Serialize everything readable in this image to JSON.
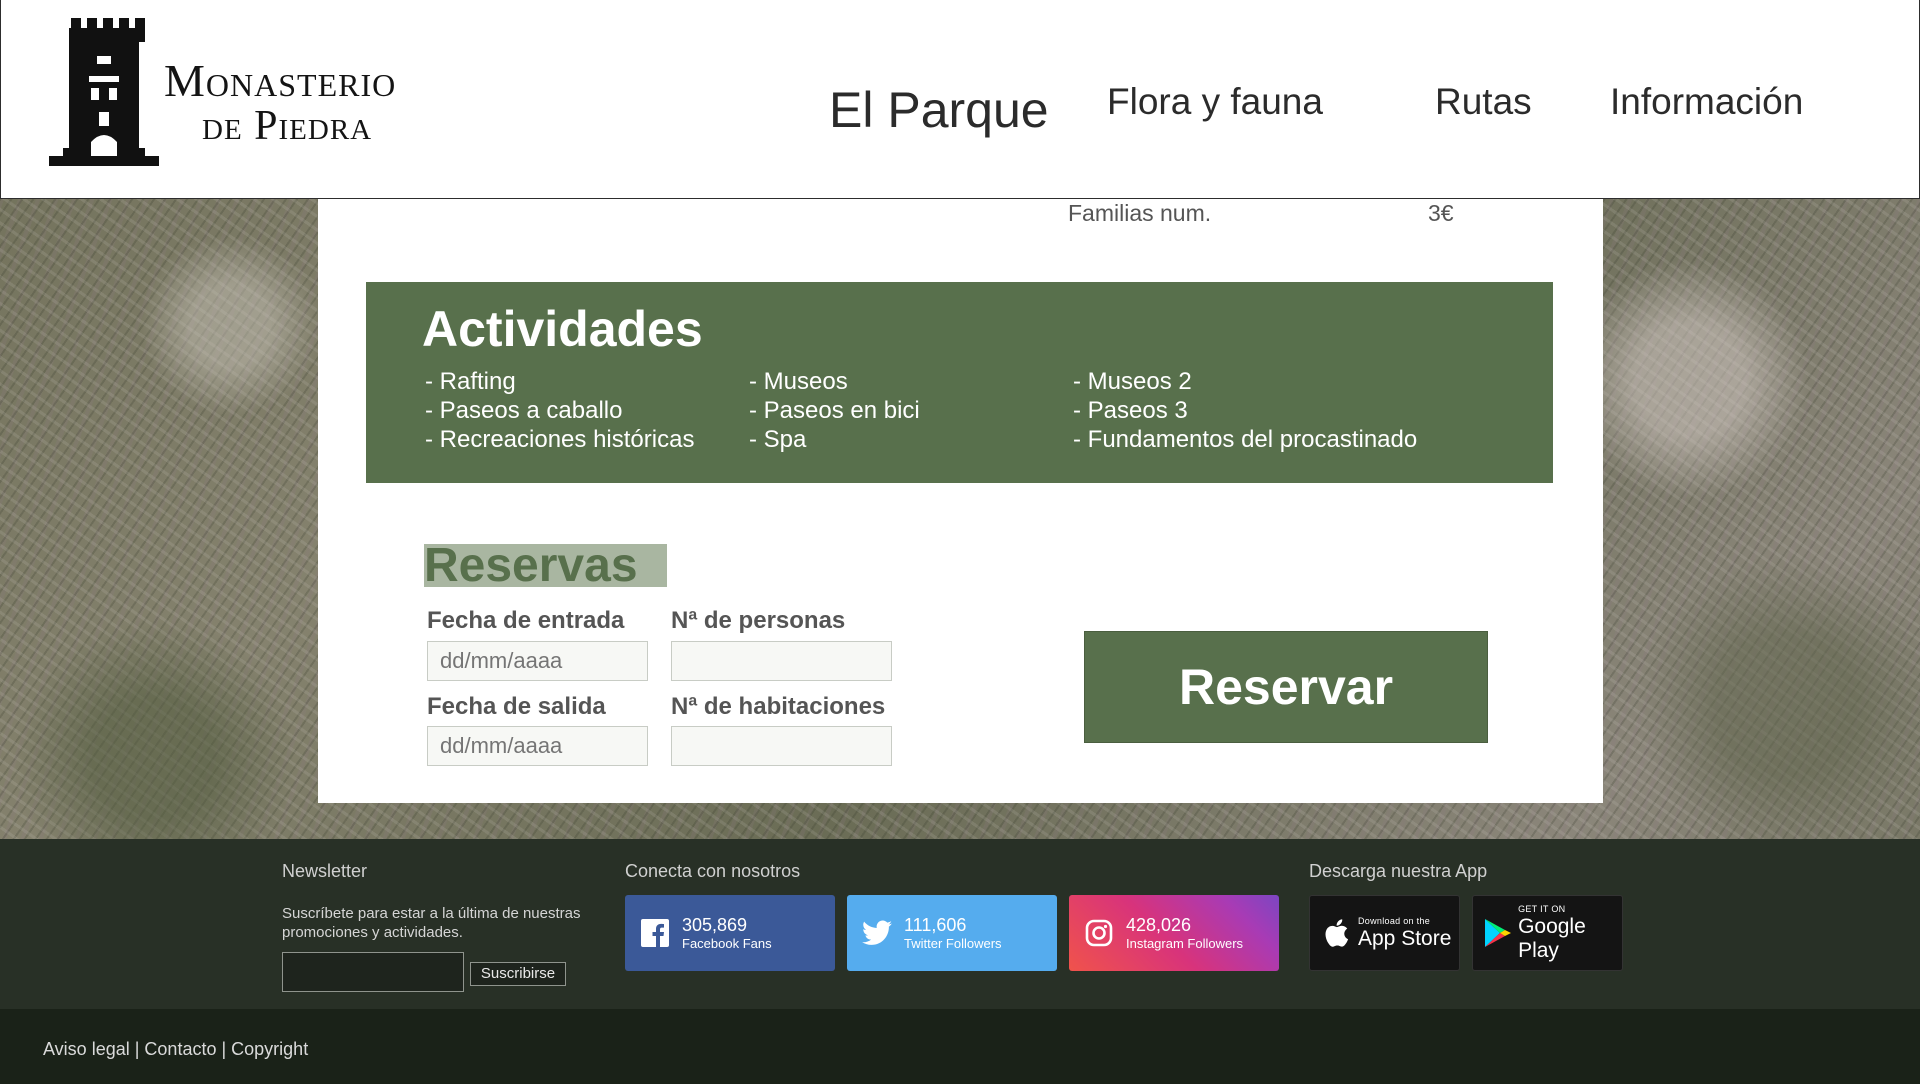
{
  "header": {
    "logo": {
      "line1": "Monasterio",
      "line2": "de Piedra"
    },
    "nav": [
      {
        "label": "El Parque"
      },
      {
        "label": "Flora y fauna"
      },
      {
        "label": "Rutas"
      },
      {
        "label": "Información"
      }
    ]
  },
  "prices": {
    "row_label": "Familias num.",
    "row_value": "3€"
  },
  "activities": {
    "title": "Actividades",
    "columns": [
      [
        "- Rafting",
        "- Paseos a caballo",
        "- Recreaciones históricas"
      ],
      [
        "- Museos",
        "- Paseos en bici",
        "- Spa"
      ],
      [
        "- Museos 2",
        "- Paseos 3",
        "- Fundamentos del procastinado"
      ]
    ]
  },
  "reservas": {
    "title": "Reservas",
    "fields": {
      "entrada": {
        "label": "Fecha de entrada",
        "placeholder": "dd/mm/aaaa"
      },
      "personas": {
        "label": "Nª de personas",
        "placeholder": ""
      },
      "salida": {
        "label": "Fecha de salida",
        "placeholder": "dd/mm/aaaa"
      },
      "habitaciones": {
        "label": "Nª de habitaciones",
        "placeholder": ""
      }
    },
    "button": "Reservar"
  },
  "footer": {
    "newsletter": {
      "heading": "Newsletter",
      "text": "Suscríbete para estar a la última de nuestras promociones y actividades.",
      "button": "Suscribirse"
    },
    "social": {
      "heading": "Conecta con nosotros",
      "items": [
        {
          "count": "305,869",
          "label": "Facebook Fans",
          "icon": "facebook-icon",
          "color": "#3b5998"
        },
        {
          "count": "111,606",
          "label": "Twitter Followers",
          "icon": "twitter-icon",
          "color": "#55acee"
        },
        {
          "count": "428,026",
          "label": "Instagram Followers",
          "icon": "instagram-icon",
          "color": "#d8337b"
        }
      ]
    },
    "app": {
      "heading": "Descarga nuestra App",
      "apple": {
        "small": "Download on the",
        "big": "App Store",
        "icon": "apple-icon"
      },
      "google": {
        "small": "GET IT ON",
        "big": "Google Play",
        "icon": "google-play-icon"
      }
    }
  },
  "bottom": {
    "links": [
      "Aviso legal",
      "Contacto",
      "Copyright"
    ],
    "separator": " | "
  },
  "colors": {
    "green": "#58704c",
    "light_green": "#a9b6a1",
    "footer_bg": "#283026",
    "bottom_bg": "#1a2218"
  }
}
